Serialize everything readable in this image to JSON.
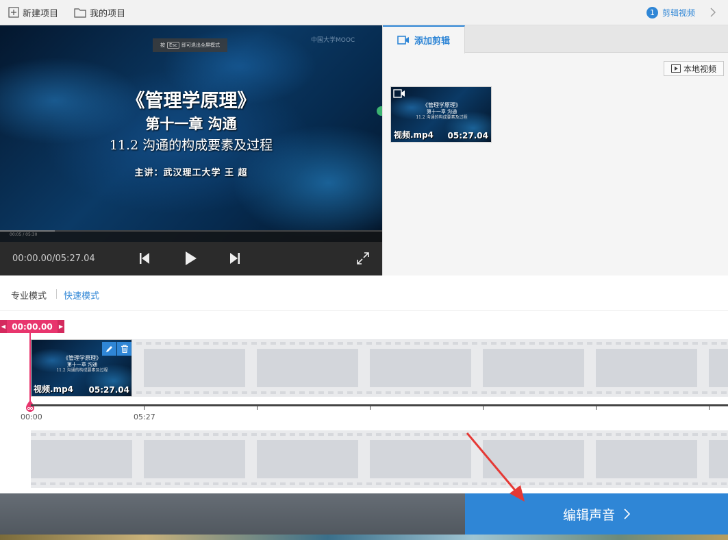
{
  "topbar": {
    "new_project": "新建项目",
    "my_projects": "我的项目",
    "step_number": "1",
    "step_label": "剪辑视频"
  },
  "player": {
    "esc_hint_prefix": "按",
    "esc_key": "Esc",
    "esc_hint_suffix": "即可退出全屏模式",
    "watermark": "中国大学MOOC",
    "title_line": "《管理学原理》",
    "chapter_line": "第十一章  沟通",
    "section_line": "11.2  沟通的构成要素及过程",
    "lecturer_line": "主讲：武汉理工大学  王  超",
    "mini_time": "00:05 / 05:30",
    "timecode": "00:00.00/05:27.04",
    "progress": 0.0
  },
  "right_panel": {
    "tab_label": "添加剪辑",
    "local_video_button": "本地视频",
    "clip": {
      "filename": "视频.mp4",
      "duration": "05:27.04"
    }
  },
  "modes": {
    "pro": "专业模式",
    "fast": "快速模式",
    "active": "fast"
  },
  "timeline": {
    "playhead_time": "00:00.00",
    "clip": {
      "filename": "视频.mp4",
      "duration": "05:27.04"
    },
    "ruler_labels": [
      "00:00",
      "05:27"
    ]
  },
  "bottom": {
    "next_button": "编辑声音"
  },
  "colors": {
    "accent": "#2f86d6",
    "playhead": "#e8356d",
    "annotation": "#e53935"
  }
}
